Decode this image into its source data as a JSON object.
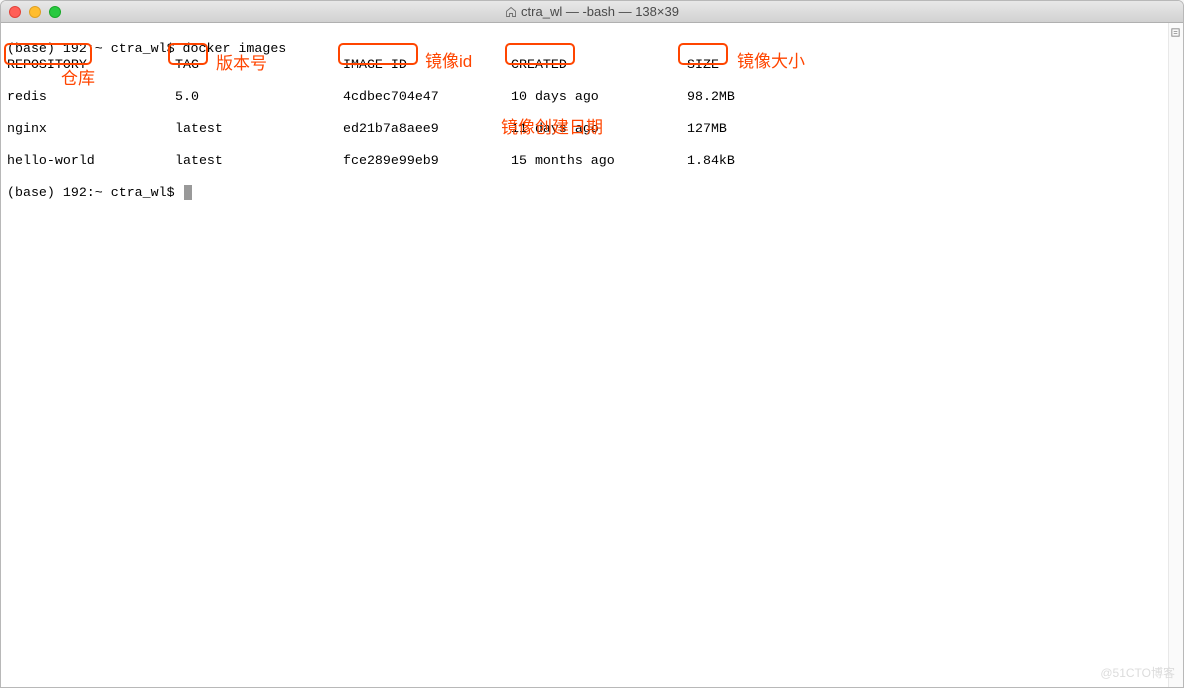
{
  "window": {
    "title": "ctra_wl — -bash — 138×39"
  },
  "terminal": {
    "prompt_line": "(base) 192:~ ctra_wl$ docker images",
    "headers": {
      "repository": "REPOSITORY",
      "tag": "TAG",
      "image_id": "IMAGE ID",
      "created": "CREATED",
      "size": "SIZE"
    },
    "rows": [
      {
        "repository": "redis",
        "tag": "5.0",
        "image_id": "4cdbec704e47",
        "created": "10 days ago",
        "size": "98.2MB"
      },
      {
        "repository": "nginx",
        "tag": "latest",
        "image_id": "ed21b7a8aee9",
        "created": "11 days ago",
        "size": "127MB"
      },
      {
        "repository": "hello-world",
        "tag": "latest",
        "image_id": "fce289e99eb9",
        "created": "15 months ago",
        "size": "1.84kB"
      }
    ],
    "prompt_idle": "(base) 192:~ ctra_wl$ "
  },
  "annotations": {
    "repository": "仓库",
    "tag": "版本号",
    "image_id": "镜像id",
    "created": "镜像创建日期",
    "size": "镜像大小"
  },
  "watermark": "@51CTO博客"
}
